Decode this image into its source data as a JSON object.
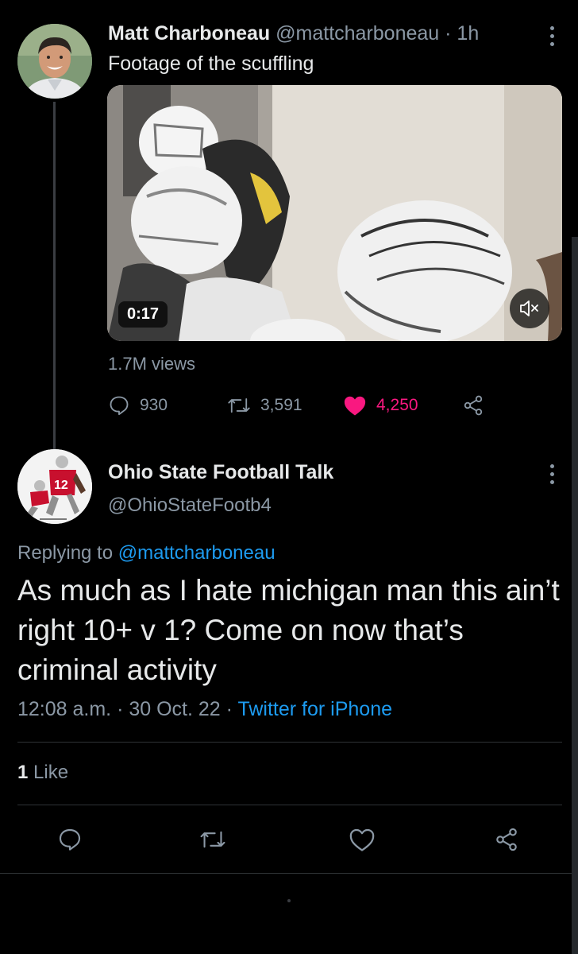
{
  "tweet1": {
    "name": "Matt Charboneau",
    "handle": "@mattcharboneau",
    "time": "· 1h",
    "text": "Footage of the scuffling",
    "video_duration": "0:17",
    "views": "1.7M views",
    "replies": "930",
    "retweets": "3,591",
    "likes": "4,250"
  },
  "tweet2": {
    "name": "Ohio State Football Talk",
    "handle": "@OhioStateFootb4",
    "avatar_number": "12",
    "replying_prefix": "Replying to",
    "replying_to": "@mattcharboneau",
    "text": "As much as I hate michigan man this ain’t right 10+ v 1? Come on now that’s criminal activity",
    "timestamp": "12:08 a.m. · 30 Oct. 22 ·",
    "source": "Twitter for iPhone",
    "likes_count": "1",
    "likes_word": "Like"
  },
  "colors": {
    "background": "#000000",
    "accent": "#1d9bf0",
    "like": "#f91880",
    "muted": "#8b98a5"
  },
  "icons": [
    "more-icon",
    "mute-icon",
    "reply-icon",
    "retweet-icon",
    "heart-icon",
    "share-icon"
  ]
}
